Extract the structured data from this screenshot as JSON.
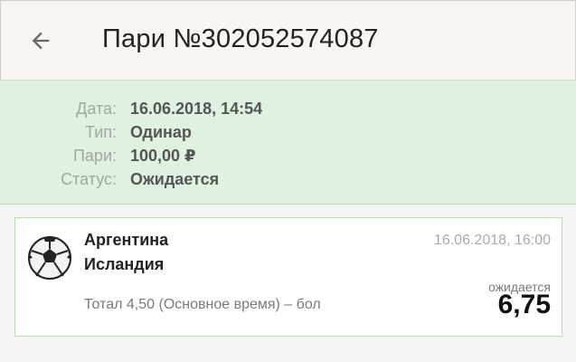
{
  "header": {
    "title": "Пари №302052574087",
    "back_icon": "arrow-left-icon"
  },
  "bet_info": {
    "rows": [
      {
        "label": "Дата:",
        "value": "16.06.2018, 14:54"
      },
      {
        "label": "Тип:",
        "value": "Одинар"
      },
      {
        "label": "Пари:",
        "value": "100,00 ₽"
      },
      {
        "label": "Статус:",
        "value": "Ожидается"
      }
    ]
  },
  "event": {
    "sport_icon": "soccer-ball-icon",
    "team_home": "Аргентина",
    "team_away": "Исландия",
    "datetime": "16.06.2018, 16:00",
    "market": "Тотал 4,50 (Основное время) – бол",
    "status": "ожидается",
    "odds": "6,75"
  },
  "colors": {
    "header_bg": "#fbf5f2",
    "info_bg": "#dff1e1",
    "card_border": "#b7deb9"
  }
}
